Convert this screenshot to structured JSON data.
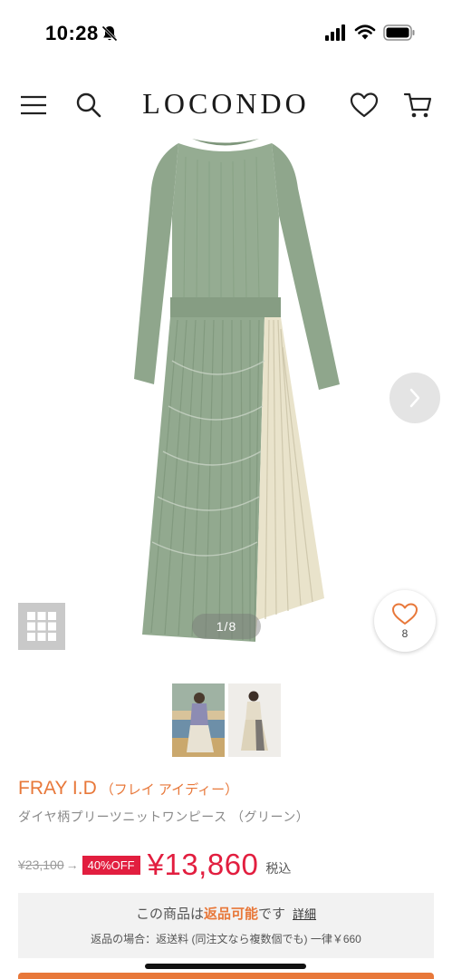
{
  "status_bar": {
    "time": "10:28",
    "icons": [
      "bell-slash-icon",
      "signal-icon",
      "wifi-icon",
      "battery-icon"
    ]
  },
  "header": {
    "logo": "LOCONDO",
    "icons": [
      "menu-icon",
      "search-icon",
      "heart-icon",
      "cart-icon"
    ]
  },
  "gallery": {
    "counter": "1/8",
    "favorite_count": "8",
    "colors": {
      "top_green": "#92a98f",
      "skirt_cream": "#e9e3cb"
    }
  },
  "product": {
    "brand": "FRAY I.D",
    "brand_kana": "（フレイ アイディー）",
    "name": "ダイヤ柄プリーツニットワンピース （グリーン）",
    "original_price": "¥23,100",
    "arrow": "→",
    "discount_badge": "40%OFF",
    "price": "¥13,860",
    "tax_label": "税込"
  },
  "returns": {
    "prefix": "この商品は",
    "highlight": "返品可能",
    "suffix": "です",
    "detail_link": "詳細",
    "note": "返品の場合：返送料 (同注文なら複数個でも) 一律￥660"
  },
  "colors": {
    "accent": "#e8783a",
    "sale": "#e21e3f",
    "muted_text": "#8a8a8a"
  }
}
